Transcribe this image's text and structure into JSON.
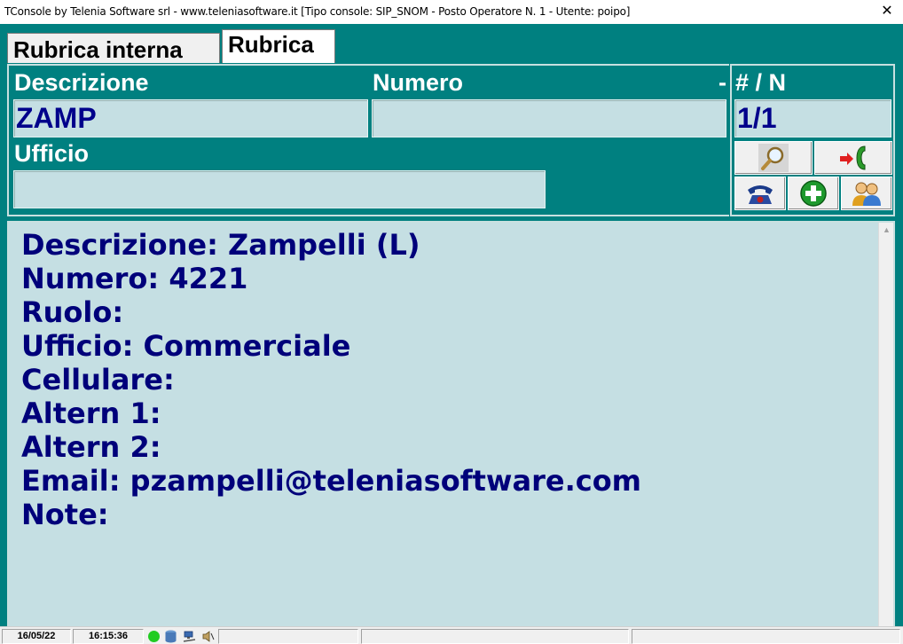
{
  "window": {
    "title": "TConsole by Telenia Software srl - www.teleniasoftware.it    [Tipo console: SIP_SNOM - Posto Operatore N. 1 - Utente: poipo]",
    "close_glyph": "✕"
  },
  "tabs": [
    {
      "label": "Rubrica interna",
      "active": false
    },
    {
      "label": "Rubrica",
      "active": true
    }
  ],
  "search": {
    "descrizione_label": "Descrizione",
    "descrizione_value": "ZAMP",
    "numero_label": "Numero",
    "numero_value": "",
    "dash": "-",
    "ufficio_label": "Ufficio",
    "ufficio_value": "",
    "count_label": "# / N",
    "count_value": "1/1"
  },
  "actions": [
    {
      "name": "search",
      "icon": "magnifier-icon"
    },
    {
      "name": "transfer",
      "icon": "call-transfer-icon"
    },
    {
      "name": "call",
      "icon": "telephone-icon"
    },
    {
      "name": "add",
      "icon": "plus-circle-icon"
    },
    {
      "name": "contacts",
      "icon": "users-icon"
    }
  ],
  "detail": {
    "lines": [
      "Descrizione: Zampelli (L)",
      "Numero: 4221",
      "Ruolo:",
      "Ufficio: Commerciale",
      "Cellulare:",
      "Altern 1:",
      "Altern 2:",
      "Email: pzampelli@teleniasoftware.com",
      "Note:"
    ]
  },
  "status": {
    "date": "16/05/22",
    "time": "16:15:36",
    "icons": [
      "green-status-icon",
      "database-icon",
      "network-icon",
      "speaker-icon"
    ]
  },
  "colors": {
    "app_bg": "#008080",
    "field_bg": "#c5dfe3",
    "detail_text": "#00007a"
  }
}
